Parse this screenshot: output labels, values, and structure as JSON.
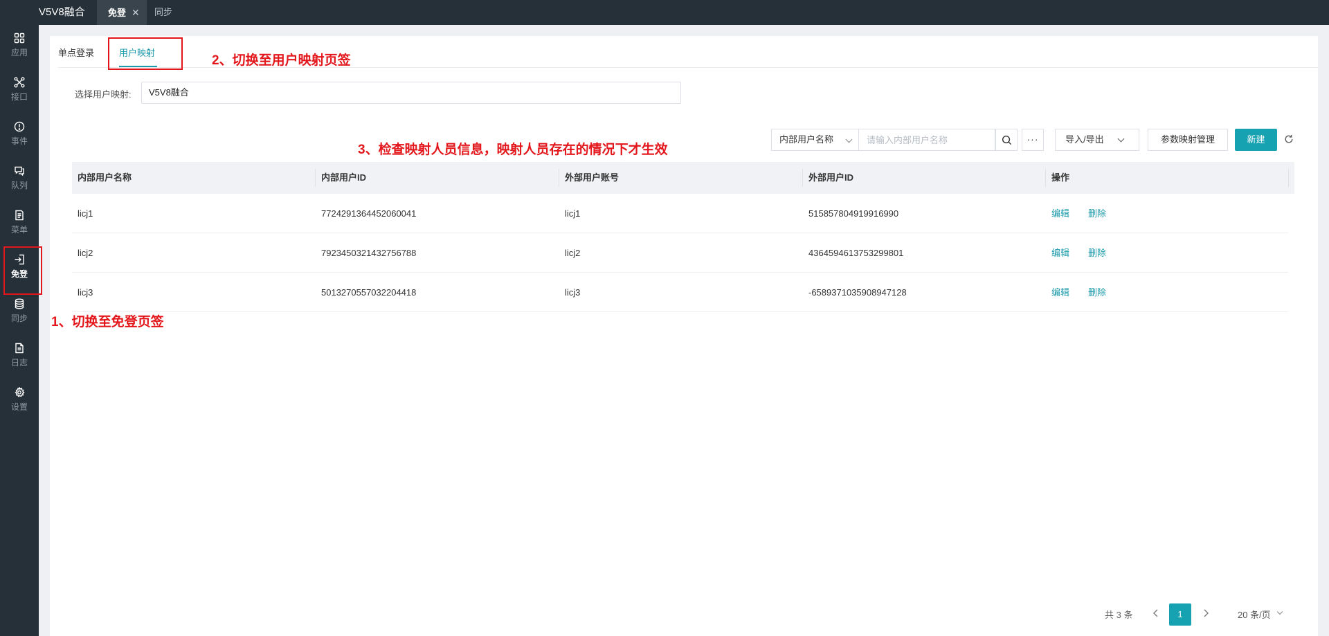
{
  "header": {
    "app_title": "V5V8融合",
    "tabs": [
      {
        "label": "免登",
        "active": true
      },
      {
        "label": "同步",
        "active": false
      }
    ]
  },
  "sidebar": {
    "items": [
      {
        "label": "应用",
        "icon": "grid-icon"
      },
      {
        "label": "接口",
        "icon": "interface-icon"
      },
      {
        "label": "事件",
        "icon": "alert-icon"
      },
      {
        "label": "队列",
        "icon": "queue-icon"
      },
      {
        "label": "菜单",
        "icon": "menu-doc-icon"
      },
      {
        "label": "免登",
        "icon": "login-icon",
        "active": true
      },
      {
        "label": "同步",
        "icon": "database-icon"
      },
      {
        "label": "日志",
        "icon": "log-icon"
      },
      {
        "label": "设置",
        "icon": "gear-icon"
      }
    ]
  },
  "subtabs": [
    {
      "label": "单点登录"
    },
    {
      "label": "用户映射",
      "active": true
    }
  ],
  "select_mapping": {
    "label": "选择用户映射:",
    "value": "V5V8融合"
  },
  "toolbar": {
    "filter_field": "内部用户名称",
    "search_placeholder": "请输入内部用户名称",
    "more_label": "···",
    "import_export": "导入/导出",
    "param_mapping": "参数映射管理",
    "new": "新建"
  },
  "table": {
    "columns": [
      "内部用户名称",
      "内部用户ID",
      "外部用户账号",
      "外部用户ID",
      "操作"
    ],
    "rows": [
      {
        "name": "licj1",
        "internal_id": "7724291364452060041",
        "external_account": "licj1",
        "external_id": "515857804919916990"
      },
      {
        "name": "licj2",
        "internal_id": "7923450321432756788",
        "external_account": "licj2",
        "external_id": "4364594613753299801"
      },
      {
        "name": "licj3",
        "internal_id": "5013270557032204418",
        "external_account": "licj3",
        "external_id": "-6589371035908947128"
      }
    ],
    "actions": {
      "edit": "编辑",
      "delete": "删除"
    }
  },
  "pagination": {
    "total": "共 3 条",
    "current": "1",
    "page_size": "20 条/页"
  },
  "annotations": {
    "step1": "1、切换至免登页签",
    "step2": "2、切换至用户映射页签",
    "step3": "3、检查映射人员信息，映射人员存在的情况下才生效"
  },
  "colors": {
    "accent": "#17a2b1",
    "annotation": "#e3161b",
    "sidebar_bg": "#263038"
  }
}
